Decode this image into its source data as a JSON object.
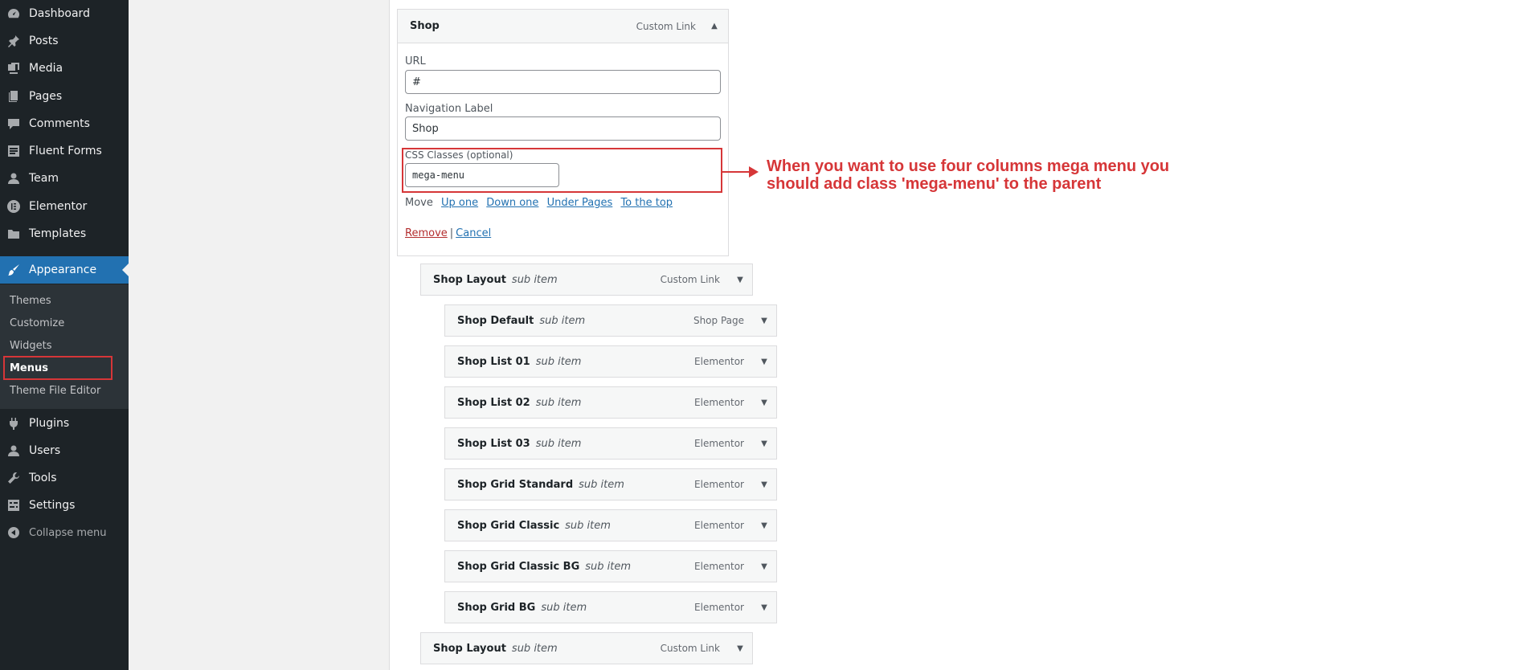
{
  "sidebar": {
    "items": [
      {
        "label": "Dashboard",
        "icon": "dashboard-icon"
      },
      {
        "label": "Posts",
        "icon": "pin-icon"
      },
      {
        "label": "Media",
        "icon": "media-icon"
      },
      {
        "label": "Pages",
        "icon": "pages-icon"
      },
      {
        "label": "Comments",
        "icon": "comments-icon"
      },
      {
        "label": "Fluent Forms",
        "icon": "forms-icon"
      },
      {
        "label": "Team",
        "icon": "user-icon"
      },
      {
        "label": "Elementor",
        "icon": "elementor-icon"
      },
      {
        "label": "Templates",
        "icon": "folder-icon"
      },
      {
        "label": "Appearance",
        "icon": "brush-icon"
      }
    ],
    "submenu": [
      "Themes",
      "Customize",
      "Widgets",
      "Menus",
      "Theme File Editor"
    ],
    "bottom_items": [
      {
        "label": "Plugins",
        "icon": "plugin-icon"
      },
      {
        "label": "Users",
        "icon": "user-icon"
      },
      {
        "label": "Tools",
        "icon": "wrench-icon"
      },
      {
        "label": "Settings",
        "icon": "settings-icon"
      }
    ],
    "collapse_label": "Collapse menu"
  },
  "shop": {
    "title": "Shop",
    "type": "Custom Link",
    "url_label": "URL",
    "url_value": "#",
    "nav_label": "Navigation Label",
    "nav_value": "Shop",
    "css_label": "CSS Classes (optional)",
    "css_value": "mega-menu",
    "move_label": "Move",
    "move_links": [
      "Up one",
      "Down one",
      "Under Pages",
      "To the top"
    ],
    "remove_label": "Remove",
    "separator": "|",
    "cancel_label": "Cancel"
  },
  "menu_items": [
    {
      "title": "Shop Layout",
      "sub": "sub item",
      "type": "Custom Link"
    },
    {
      "title": "Shop Default",
      "sub": "sub item",
      "type": "Shop Page"
    },
    {
      "title": "Shop List 01",
      "sub": "sub item",
      "type": "Elementor"
    },
    {
      "title": "Shop List 02",
      "sub": "sub item",
      "type": "Elementor"
    },
    {
      "title": "Shop List 03",
      "sub": "sub item",
      "type": "Elementor"
    },
    {
      "title": "Shop Grid Standard",
      "sub": "sub item",
      "type": "Elementor"
    },
    {
      "title": "Shop Grid Classic",
      "sub": "sub item",
      "type": "Elementor"
    },
    {
      "title": "Shop Grid Classic BG",
      "sub": "sub item",
      "type": "Elementor"
    },
    {
      "title": "Shop Grid BG",
      "sub": "sub item",
      "type": "Elementor"
    },
    {
      "title": "Shop Layout",
      "sub": "sub item",
      "type": "Custom Link"
    }
  ],
  "annotation": {
    "line1": "When you want to use four columns mega menu you",
    "line2": "should add class 'mega-menu' to the parent",
    "color": "#d63638"
  }
}
